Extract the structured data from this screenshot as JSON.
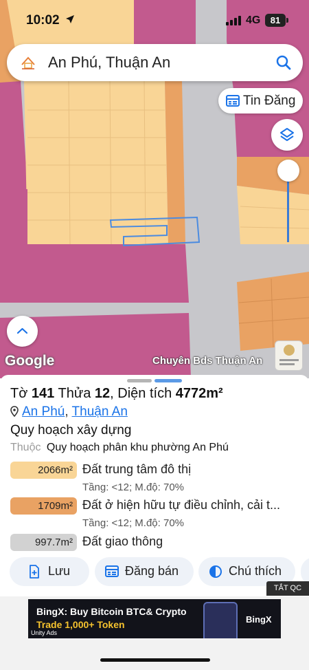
{
  "status_bar": {
    "time": "10:02",
    "network": "4G",
    "battery": "81"
  },
  "search": {
    "query": "An Phú, Thuận An"
  },
  "map_controls": {
    "listing_button": "Tin Đăng"
  },
  "map_footer": {
    "google": "Google",
    "watermark": "Chuyên Bds Thuận An"
  },
  "parcel": {
    "sheet_label": "Tờ",
    "sheet_no": "141",
    "plot_label": "Thửa",
    "plot_no": "12",
    "area_label": "Diện tích",
    "area": "4772m²",
    "ward": "An Phú",
    "district": "Thuận An",
    "separator": ",",
    "section_title": "Quy hoạch xây dựng",
    "belongs_label": "Thuộc",
    "belongs_value": "Quy hoạch phân khu phường An Phú"
  },
  "zones": [
    {
      "area": "2066m²",
      "name": "Đất trung tâm đô thị",
      "meta": "Tầng: <12; M.độ: 70%",
      "color": "#f9d596"
    },
    {
      "area": "1709m²",
      "name": "Đất ở hiện hữu tự điều chỉnh, cải t...",
      "meta": "Tầng: <12; M.độ: 70%",
      "color": "#e9a263"
    },
    {
      "area": "997.7m²",
      "name": "Đất giao thông",
      "meta": "",
      "color": "#d2d2d2"
    }
  ],
  "actions": [
    {
      "label": "Lưu",
      "icon": "bookmark-plus-icon"
    },
    {
      "label": "Đăng bán",
      "icon": "calendar-list-icon"
    },
    {
      "label": "Chú thích",
      "icon": "half-circle-icon"
    }
  ],
  "ad": {
    "close_label": "TẮT QC",
    "line1": "BingX: Buy Bitcoin BTC& Crypto",
    "line2": "Trade 1,000+ Token",
    "brand": "BingX",
    "network": "Unity Ads"
  },
  "colors": {
    "map_magenta": "#c25a8e",
    "map_orange": "#e9a263",
    "map_yellow": "#f9d596",
    "map_road": "#c7c7cb",
    "accent_blue": "#1a73e8"
  }
}
